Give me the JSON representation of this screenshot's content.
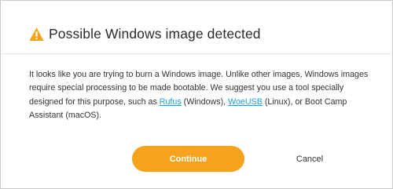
{
  "dialog": {
    "title": "Possible Windows image detected",
    "icon": "warning-triangle-icon",
    "message": {
      "part1": "It looks like you are trying to burn a Windows image. Unlike other images, Windows images require special processing to be made bootable. We suggest you use a tool specially designed for this purpose, such as ",
      "link_rufus": "Rufus",
      "part2": " (Windows), ",
      "link_woeusb": "WoeUSB",
      "part3": " (Linux), or Boot Camp Assistant (macOS)."
    },
    "continue_label": "Continue",
    "cancel_label": "Cancel"
  },
  "colors": {
    "accent": "#f7a21b",
    "link": "#1a9fd6",
    "warning": "#f7a21b"
  }
}
